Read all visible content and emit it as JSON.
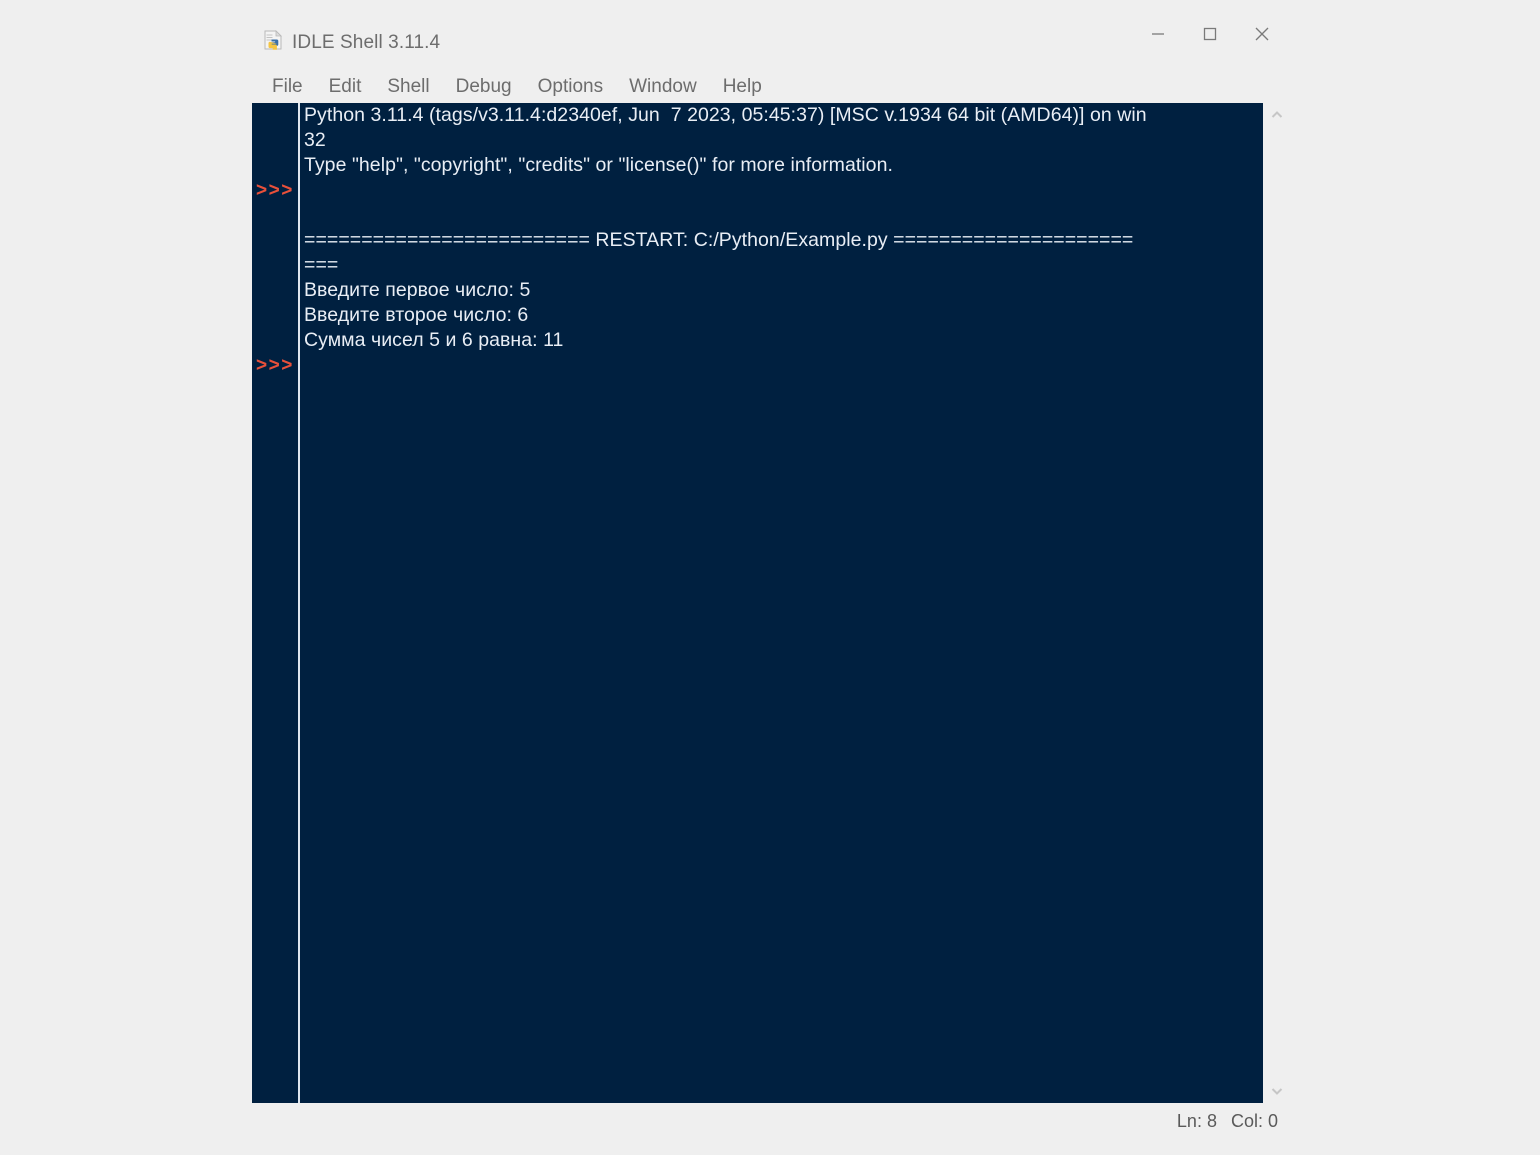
{
  "window": {
    "title": "IDLE Shell 3.11.4",
    "icon": "python-file-icon",
    "controls": {
      "minimize": "minimize-icon",
      "maximize": "maximize-icon",
      "close": "close-icon"
    }
  },
  "menubar": {
    "items": [
      {
        "label": "File"
      },
      {
        "label": "Edit"
      },
      {
        "label": "Shell"
      },
      {
        "label": "Debug"
      },
      {
        "label": "Options"
      },
      {
        "label": "Window"
      },
      {
        "label": "Help"
      }
    ]
  },
  "console": {
    "background_color": "#002040",
    "text_color": "#e9eef5",
    "prompt_color": "#e8503a",
    "prompt_symbol": ">>>",
    "lines": [
      {
        "text": "Python 3.11.4 (tags/v3.11.4:d2340ef, Jun  7 2023, 05:45:37) [MSC v.1934 64 bit (AMD64)] on win",
        "prompt": false
      },
      {
        "text": "32",
        "prompt": false
      },
      {
        "text": "Type \"help\", \"copyright\", \"credits\" or \"license()\" for more information.",
        "prompt": false
      },
      {
        "text": "",
        "prompt": true
      },
      {
        "text": "",
        "prompt": false
      },
      {
        "text": "========================= RESTART: C:/Python/Example.py =====================",
        "prompt": false
      },
      {
        "text": "===",
        "prompt": false
      },
      {
        "text": "Введите первое число: 5",
        "prompt": false
      },
      {
        "text": "Введите второе число: 6",
        "prompt": false
      },
      {
        "text": "Сумма чисел 5 и 6 равна: 11",
        "prompt": false
      },
      {
        "text": "",
        "prompt": true
      }
    ]
  },
  "scrollbar": {
    "up_arrow": "chevron-up-icon",
    "down_arrow": "chevron-down-icon"
  },
  "statusbar": {
    "line_label": "Ln: 8",
    "col_label": "Col: 0"
  }
}
